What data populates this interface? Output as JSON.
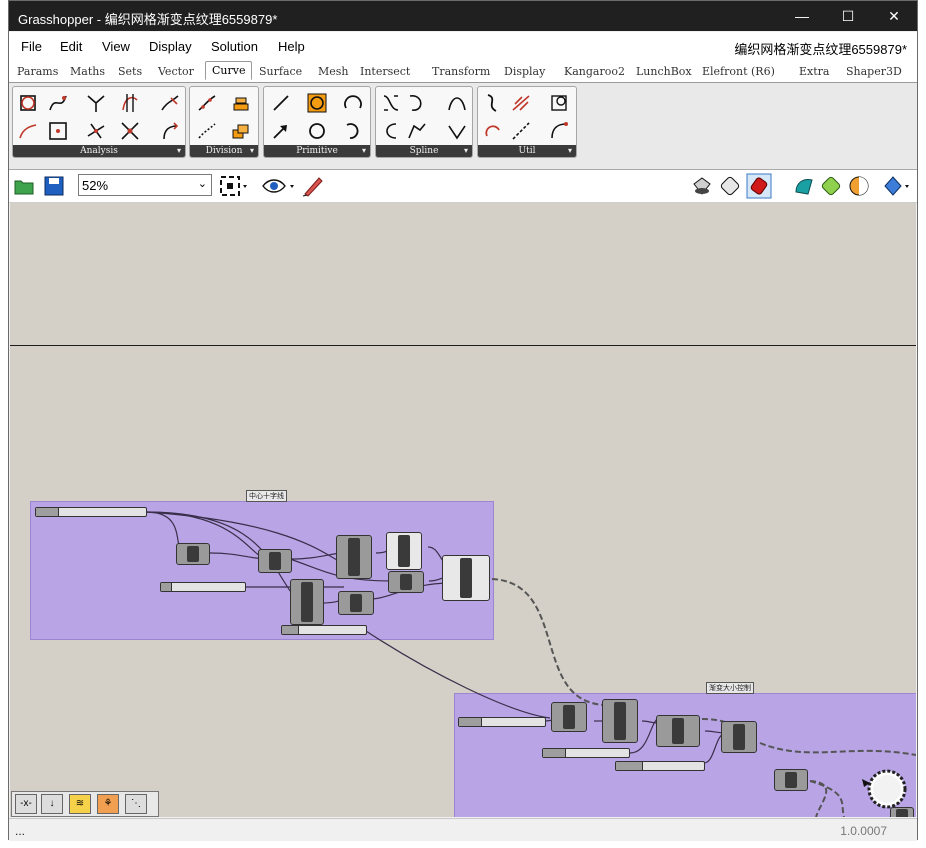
{
  "window": {
    "title": "Grasshopper - 编织网格渐变点纹理6559879*",
    "controls": {
      "minimize": "—",
      "maximize": "☐",
      "close": "✕"
    }
  },
  "menu": {
    "items": [
      "File",
      "Edit",
      "View",
      "Display",
      "Solution",
      "Help"
    ],
    "document_name": "编织网格渐变点纹理6559879*"
  },
  "tabs": [
    "Params",
    "Maths",
    "Sets",
    "Vector",
    "Curve",
    "Surface",
    "Mesh",
    "Intersect",
    "Transform",
    "Display",
    "Kangaroo2",
    "LunchBox",
    "Elefront (R6)",
    "Extra",
    "Shaper3D"
  ],
  "active_tab": "Curve",
  "ribbon": {
    "panels": [
      {
        "label": "Analysis",
        "icons": [
          "curvature-icon",
          "curve-closest-icon",
          "branch-icon",
          "tangent-icon",
          "curve-frame-icon",
          "end-points-icon",
          "polygon-center-icon",
          "perpendicular-icon",
          "discontinuity-icon",
          "curve-length-icon"
        ]
      },
      {
        "label": "Division",
        "icons": [
          "divide-curve-icon",
          "contour-icon",
          "shatter-icon",
          "dash-pattern-icon"
        ]
      },
      {
        "label": "Primitive",
        "icons": [
          "line-icon",
          "arc-icon",
          "circle-3pt-icon",
          "vector-line-icon",
          "circle-icon",
          "arc-sed-icon"
        ]
      },
      {
        "label": "Spline",
        "icons": [
          "interpolate-icon",
          "bezier-icon",
          "nurbs-icon",
          "polyline-icon",
          "kinky-curve-icon",
          "tangent-curve-icon"
        ]
      },
      {
        "label": "Util",
        "icons": [
          "offset-icon",
          "fillet-icon",
          "project-icon",
          "flip-icon",
          "join-icon",
          "extend-icon"
        ]
      }
    ],
    "panel_arrow": "▾"
  },
  "toolbar": {
    "zoom": "52%",
    "zoom_chevron": "⌄",
    "icons": [
      "open-file-icon",
      "save-file-icon",
      "zoom-extents-icon",
      "preview-eye-icon",
      "sketch-pen-icon",
      "paint-bucket-icon",
      "wire-display-icon",
      "preview-red-icon",
      "shaded-teal-icon",
      "material-green-icon",
      "gradient-sphere-icon",
      "blue-sphere-icon"
    ]
  },
  "canvas": {
    "group1_label": "中心十字线",
    "group2_label": "渐变大小控制"
  },
  "navigation": {
    "buttons": [
      "-x-",
      "↓",
      "≋",
      "⚘",
      "⋱"
    ]
  },
  "status": {
    "left": "...",
    "version": "1.0.0007"
  },
  "colors": {
    "titlebar": "#202020",
    "group_fill": "#b9a5e6",
    "canvas": "#d4d0c8"
  }
}
